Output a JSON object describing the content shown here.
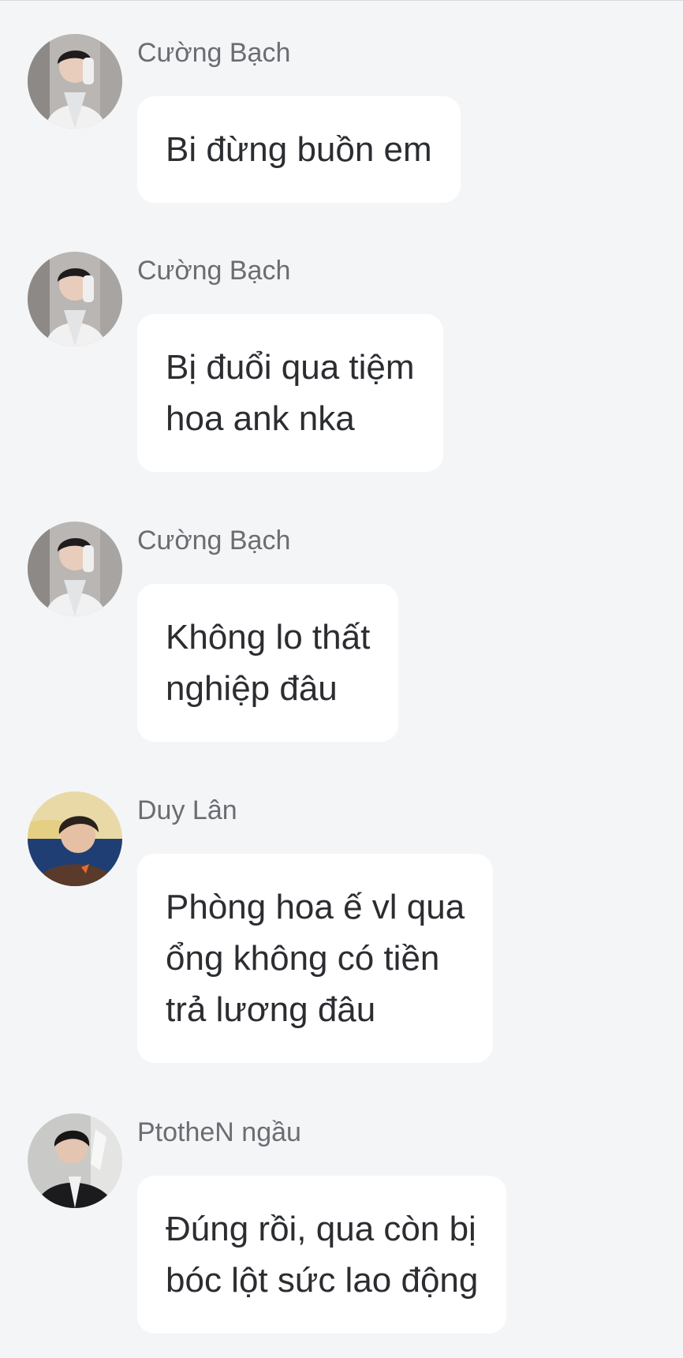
{
  "messages": [
    {
      "sender": "Cường Bạch",
      "avatar_icon": "avatar-cuong-bach-icon",
      "lines": [
        "Bi đừng buồn em"
      ]
    },
    {
      "sender": "Cường Bạch",
      "avatar_icon": "avatar-cuong-bach-icon",
      "lines": [
        "Bị đuổi qua tiệm",
        "hoa ank nka"
      ]
    },
    {
      "sender": "Cường Bạch",
      "avatar_icon": "avatar-cuong-bach-icon",
      "lines": [
        "Không lo thất",
        "nghiệp đâu"
      ]
    },
    {
      "sender": "Duy Lân",
      "avatar_icon": "avatar-duy-lan-icon",
      "lines": [
        "Phòng hoa ế vl qua",
        "ổng không có tiền",
        "trả lương đâu"
      ]
    },
    {
      "sender": "PtotheN ngầu",
      "avatar_icon": "avatar-ptothen-icon",
      "lines": [
        "Đúng rồi, qua còn bị",
        "bóc lột sức lao động"
      ]
    }
  ],
  "colors": {
    "background": "#f4f5f7",
    "bubble": "#ffffff",
    "message_text": "#2b2d31",
    "sender_text": "#6b6d72"
  }
}
